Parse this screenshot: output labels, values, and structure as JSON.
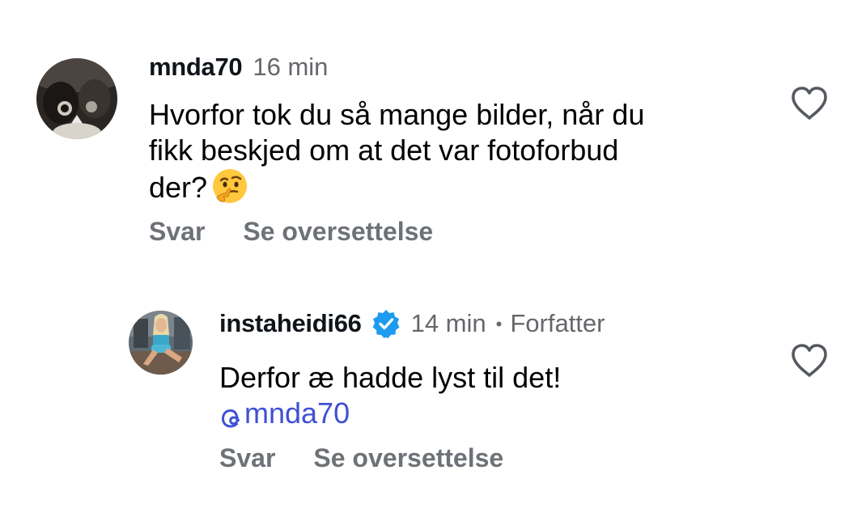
{
  "comments": [
    {
      "username": "mnda70",
      "time": "16 min",
      "text_lines": [
        "Hvorfor tok du så mange bilder, når du",
        "fikk beskjed om at det var fotoforbud",
        "der?"
      ],
      "emoji": "thinking-face",
      "reply_label": "Svar",
      "translate_label": "Se oversettelse",
      "like_icon": "heart-outline"
    },
    {
      "username": "instaheidi66",
      "verified": true,
      "time": "14 min",
      "separator": "•",
      "role": "Forfatter",
      "text": "Derfor æ hadde lyst til det!",
      "mention": "mnda70",
      "reply_label": "Svar",
      "translate_label": "Se oversettelse",
      "like_icon": "heart-outline"
    }
  ],
  "colors": {
    "username": "#0f1419",
    "meta": "#65676b",
    "action": "#6e7277",
    "mention": "#3f51d4",
    "verified": "#1d9bf0"
  }
}
